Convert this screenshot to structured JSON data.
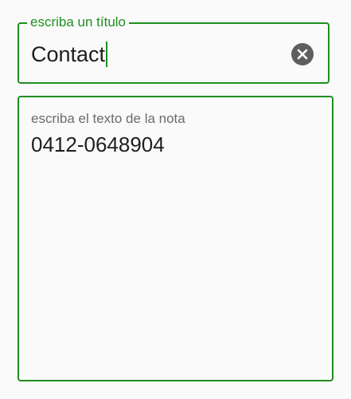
{
  "title_field": {
    "label": "escriba un título",
    "value": "Contact",
    "clear_icon": "clear-circle-icon"
  },
  "note_field": {
    "label": "escriba el texto de la nota",
    "value": "0412-0648904"
  },
  "colors": {
    "accent": "#1f8f1f",
    "background": "#fafafa",
    "text": "#1e1e1e",
    "hint": "#6b6b6b",
    "clear_icon_bg": "#5f5f5f"
  }
}
